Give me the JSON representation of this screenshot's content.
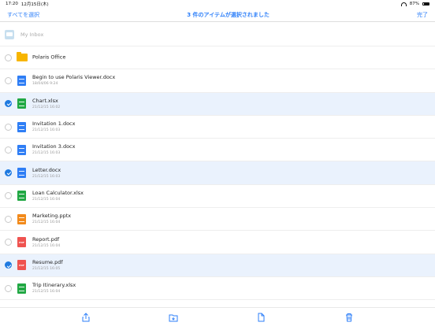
{
  "status": {
    "time": "17:20",
    "date": "12月15日(木)",
    "battery": "87%"
  },
  "nav": {
    "left": "すべてを選択",
    "title": "3 件のアイテムが選択されました",
    "right": "完了"
  },
  "inbox": {
    "label": "My Inbox"
  },
  "files": [
    {
      "name": "Polaris Office",
      "date": "",
      "type": "folder",
      "selected": false
    },
    {
      "name": "Begin to use Polaris Viewer.docx",
      "date": "18/04/06 9:24",
      "type": "doc",
      "selected": false
    },
    {
      "name": "Chart.xlsx",
      "date": "21/12/15 16:02",
      "type": "xls",
      "selected": true
    },
    {
      "name": "Invitation 1.docx",
      "date": "21/12/15 16:03",
      "type": "doc",
      "selected": false
    },
    {
      "name": "Invitation 3.docx",
      "date": "21/12/15 16:03",
      "type": "doc",
      "selected": false
    },
    {
      "name": "Letter.docx",
      "date": "21/12/15 16:03",
      "type": "doc",
      "selected": true
    },
    {
      "name": "Loan Calculator.xlsx",
      "date": "21/12/15 16:04",
      "type": "xls",
      "selected": false
    },
    {
      "name": "Marketing.pptx",
      "date": "21/12/15 16:04",
      "type": "ppt",
      "selected": false
    },
    {
      "name": "Report.pdf",
      "date": "21/12/15 16:04",
      "type": "pdf",
      "selected": false
    },
    {
      "name": "Resume.pdf",
      "date": "21/12/15 16:05",
      "type": "pdf",
      "selected": true
    },
    {
      "name": "Trip Itinerary.xlsx",
      "date": "21/12/15 16:04",
      "type": "xls",
      "selected": false
    }
  ],
  "icons": {
    "doc": "#2f7ef5",
    "xls": "#21a844",
    "ppt": "#f28a1b",
    "pdf": "#ef5350",
    "pdf_text": "PDF"
  },
  "toolbar": [
    "share-icon",
    "move-to-folder-icon",
    "copy-icon",
    "trash-icon"
  ]
}
